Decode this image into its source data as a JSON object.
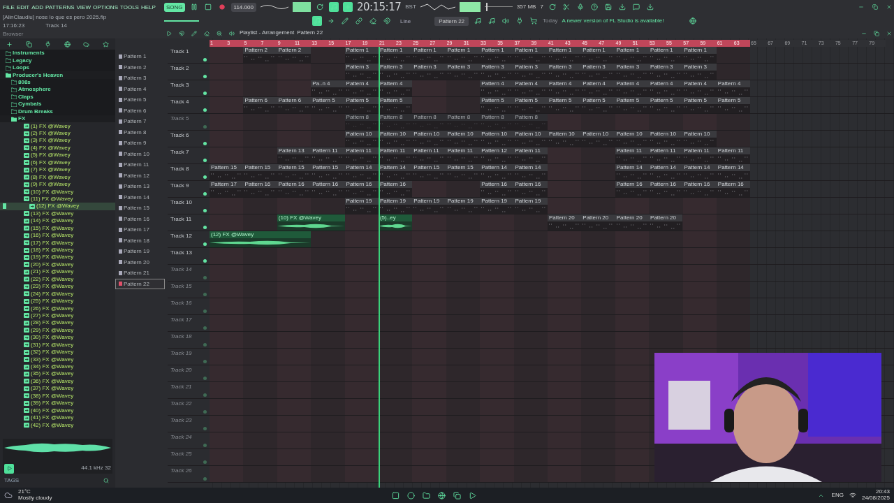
{
  "menu": [
    "FILE",
    "EDIT",
    "ADD",
    "PATTERNS",
    "VIEW",
    "OPTIONS",
    "TOOLS",
    "HELP"
  ],
  "toolbar": {
    "mode": "SONG",
    "tempo": "114.000",
    "time": "20:15:17",
    "time_unit": "BST",
    "memory": "357 MB",
    "voices": "7",
    "project": "[AlinClaudiu] nose lo que es pero 2025.flp",
    "clock": "17:16:23",
    "hint": "Track 14",
    "snap": "Line",
    "pattern": "Pattern 22",
    "news_day": "Today",
    "news": "A newer version of FL Studio is available!"
  },
  "browser": {
    "title": "Browser",
    "tree": [
      {
        "label": "Instruments",
        "expanded": false
      },
      {
        "label": "Legacy",
        "expanded": false
      },
      {
        "label": "Loops",
        "expanded": false
      },
      {
        "label": "Producer's Heaven",
        "expanded": true,
        "children": [
          {
            "label": "808s",
            "expanded": false
          },
          {
            "label": "Atmosphere",
            "expanded": false
          },
          {
            "label": "Claps",
            "expanded": false
          },
          {
            "label": "Cymbals",
            "expanded": false
          },
          {
            "label": "Drum Breaks",
            "expanded": false
          },
          {
            "label": "FX",
            "expanded": true,
            "files": [
              {
                "label": "(1) FX @Wavey",
                "selected": false
              },
              {
                "label": "(2) FX @Wavey",
                "selected": false
              },
              {
                "label": "(3) FX @Wavey",
                "selected": false
              },
              {
                "label": "(4) FX @Wavey",
                "selected": false
              },
              {
                "label": "(5) FX @Wavey",
                "selected": false
              },
              {
                "label": "(6) FX @Wavey",
                "selected": false
              },
              {
                "label": "(7) FX @Wavey",
                "selected": false
              },
              {
                "label": "(8) FX @Wavey",
                "selected": false
              },
              {
                "label": "(9) FX @Wavey",
                "selected": false
              },
              {
                "label": "(10) FX @Wavey",
                "selected": false
              },
              {
                "label": "(11) FX @Wavey",
                "selected": false
              },
              {
                "label": "(12) FX @Wavey",
                "selected": true
              },
              {
                "label": "(13) FX @Wavey",
                "selected": false
              },
              {
                "label": "(14) FX @Wavey",
                "selected": false
              },
              {
                "label": "(15) FX @Wavey",
                "selected": false
              },
              {
                "label": "(16) FX @Wavey",
                "selected": false
              },
              {
                "label": "(17) FX @Wavey",
                "selected": false
              },
              {
                "label": "(18) FX @Wavey",
                "selected": false
              },
              {
                "label": "(19) FX @Wavey",
                "selected": false
              },
              {
                "label": "(20) FX @Wavey",
                "selected": false
              },
              {
                "label": "(21) FX @Wavey",
                "selected": false
              },
              {
                "label": "(22) FX @Wavey",
                "selected": false
              },
              {
                "label": "(23) FX @Wavey",
                "selected": false
              },
              {
                "label": "(24) FX @Wavey",
                "selected": false
              },
              {
                "label": "(25) FX @Wavey",
                "selected": false
              },
              {
                "label": "(26) FX @Wavey",
                "selected": false
              },
              {
                "label": "(27) FX @Wavey",
                "selected": false
              },
              {
                "label": "(28) FX @Wavey",
                "selected": false
              },
              {
                "label": "(29) FX @Wavey",
                "selected": false
              },
              {
                "label": "(30) FX @Wavey",
                "selected": false
              },
              {
                "label": "(31) FX @Wavey",
                "selected": false
              },
              {
                "label": "(32) FX @Wavey",
                "selected": false
              },
              {
                "label": "(33) FX @Wavey",
                "selected": false
              },
              {
                "label": "(34) FX @Wavey",
                "selected": false
              },
              {
                "label": "(35) FX @Wavey",
                "selected": false
              },
              {
                "label": "(36) FX @Wavey",
                "selected": false
              },
              {
                "label": "(37) FX @Wavey",
                "selected": false
              },
              {
                "label": "(38) FX @Wavey",
                "selected": false
              },
              {
                "label": "(39) FX @Wavey",
                "selected": false
              },
              {
                "label": "(40) FX @Wavey",
                "selected": false
              },
              {
                "label": "(41) FX @Wavey",
                "selected": false
              },
              {
                "label": "(42) FX @Wavey",
                "selected": false
              }
            ]
          }
        ]
      }
    ],
    "sample_info": "44.1 kHz 32",
    "tags": "TAGS"
  },
  "playlist": {
    "title": "Playlist - Arrangement",
    "pattern": "Pattern 22",
    "patterns": [
      {
        "label": "Pattern 1",
        "selected": false
      },
      {
        "label": "Pattern 2",
        "selected": false
      },
      {
        "label": "Pattern 3",
        "selected": false
      },
      {
        "label": "Pattern 4",
        "selected": false
      },
      {
        "label": "Pattern 5",
        "selected": false
      },
      {
        "label": "Pattern 6",
        "selected": false
      },
      {
        "label": "Pattern 7",
        "selected": false
      },
      {
        "label": "Pattern 8",
        "selected": false
      },
      {
        "label": "Pattern 9",
        "selected": false
      },
      {
        "label": "Pattern 10",
        "selected": false
      },
      {
        "label": "Pattern 11",
        "selected": false
      },
      {
        "label": "Pattern 12",
        "selected": false
      },
      {
        "label": "Pattern 13",
        "selected": false
      },
      {
        "label": "Pattern 14",
        "selected": false
      },
      {
        "label": "Pattern 15",
        "selected": false
      },
      {
        "label": "Pattern 16",
        "selected": false
      },
      {
        "label": "Pattern 17",
        "selected": false
      },
      {
        "label": "Pattern 18",
        "selected": false
      },
      {
        "label": "Pattern 19",
        "selected": false
      },
      {
        "label": "Pattern 20",
        "selected": false
      },
      {
        "label": "Pattern 21",
        "selected": false
      },
      {
        "label": "Pattern 22",
        "selected": true
      }
    ],
    "ruler": [
      {
        "label": "1",
        "in_range": true
      },
      {
        "label": "3",
        "in_range": true
      },
      {
        "label": "5",
        "in_range": true
      },
      {
        "label": "7",
        "in_range": true
      },
      {
        "label": "9",
        "in_range": true
      },
      {
        "label": "11",
        "in_range": true
      },
      {
        "label": "13",
        "in_range": true
      },
      {
        "label": "15",
        "in_range": true
      },
      {
        "label": "17",
        "in_range": true
      },
      {
        "label": "19",
        "in_range": true
      },
      {
        "label": "21",
        "in_range": true
      },
      {
        "label": "23",
        "in_range": true
      },
      {
        "label": "25",
        "in_range": true
      },
      {
        "label": "27",
        "in_range": true
      },
      {
        "label": "29",
        "in_range": true
      },
      {
        "label": "31",
        "in_range": true
      },
      {
        "label": "33",
        "in_range": true
      },
      {
        "label": "35",
        "in_range": true
      },
      {
        "label": "37",
        "in_range": true
      },
      {
        "label": "39",
        "in_range": true
      },
      {
        "label": "41",
        "in_range": true
      },
      {
        "label": "43",
        "in_range": true
      },
      {
        "label": "45",
        "in_range": true
      },
      {
        "label": "47",
        "in_range": true
      },
      {
        "label": "49",
        "in_range": true
      },
      {
        "label": "51",
        "in_range": true
      },
      {
        "label": "53",
        "in_range": true
      },
      {
        "label": "55",
        "in_range": true
      },
      {
        "label": "57",
        "in_range": true
      },
      {
        "label": "59",
        "in_range": true
      },
      {
        "label": "61",
        "in_range": true
      },
      {
        "label": "63",
        "in_range": true
      },
      {
        "label": "65",
        "in_range": false
      },
      {
        "label": "67",
        "in_range": false
      },
      {
        "label": "69",
        "in_range": false
      },
      {
        "label": "71",
        "in_range": false
      },
      {
        "label": "73",
        "in_range": false
      },
      {
        "label": "75",
        "in_range": false
      },
      {
        "label": "77",
        "in_range": false
      },
      {
        "label": "79",
        "in_range": false
      }
    ],
    "tracks": [
      {
        "name": "Track 1",
        "muted": false,
        "clips": [
          {
            "kind": "gap"
          },
          {
            "kind": "pattern",
            "label": "Pattern 2"
          },
          {
            "kind": "pattern",
            "label": "Pattern 2"
          },
          {
            "kind": "gap"
          },
          {
            "kind": "pattern",
            "label": "Pattern 1"
          },
          {
            "kind": "pattern",
            "label": "Pattern 1"
          },
          {
            "kind": "pattern",
            "label": "Pattern 1"
          },
          {
            "kind": "pattern",
            "label": "Pattern 1"
          },
          {
            "kind": "pattern",
            "label": "Pattern 1"
          },
          {
            "kind": "pattern",
            "label": "Pattern 1"
          },
          {
            "kind": "pattern",
            "label": "Pattern 1"
          },
          {
            "kind": "pattern",
            "label": "Pattern 1"
          },
          {
            "kind": "pattern",
            "label": "Pattern 1"
          },
          {
            "kind": "pattern",
            "label": "Pattern 1"
          },
          {
            "kind": "pattern",
            "label": "Pattern 1"
          }
        ]
      },
      {
        "name": "Track 2",
        "muted": false,
        "clips": [
          {
            "kind": "gap"
          },
          {
            "kind": "gap"
          },
          {
            "kind": "gap"
          },
          {
            "kind": "gap"
          },
          {
            "kind": "pattern",
            "label": "Pattern 3"
          },
          {
            "kind": "pattern",
            "label": "Pattern 3"
          },
          {
            "kind": "pattern",
            "label": "Pattern 3"
          },
          {
            "kind": "pattern",
            "label": "Pattern 3"
          },
          {
            "kind": "pattern",
            "label": "Pattern 3"
          },
          {
            "kind": "pattern",
            "label": "Pattern 3"
          },
          {
            "kind": "pattern",
            "label": "Pattern 3"
          },
          {
            "kind": "pattern",
            "label": "Pattern 3"
          },
          {
            "kind": "pattern",
            "label": "Pattern 3"
          },
          {
            "kind": "pattern",
            "label": "Pattern 3"
          },
          {
            "kind": "pattern",
            "label": "Pattern 3"
          }
        ]
      },
      {
        "name": "Track 3",
        "muted": false,
        "clips": [
          {
            "kind": "gap"
          },
          {
            "kind": "gap"
          },
          {
            "kind": "gap"
          },
          {
            "kind": "pattern",
            "label": "Pa..n 4"
          },
          {
            "kind": "pattern",
            "label": "Pattern 4"
          },
          {
            "kind": "pattern",
            "label": "Pattern 4"
          },
          {
            "kind": "gap"
          },
          {
            "kind": "gap"
          },
          {
            "kind": "pattern",
            "label": "Pattern 4"
          },
          {
            "kind": "pattern",
            "label": "Pattern 4"
          },
          {
            "kind": "pattern",
            "label": "Pattern 4"
          },
          {
            "kind": "pattern",
            "label": "Pattern 4"
          },
          {
            "kind": "pattern",
            "label": "Pattern 4"
          },
          {
            "kind": "pattern",
            "label": "Pattern 4"
          },
          {
            "kind": "pattern",
            "label": "Pattern 4"
          },
          {
            "kind": "pattern",
            "label": "Pattern 4"
          }
        ]
      },
      {
        "name": "Track 4",
        "muted": false,
        "clips": [
          {
            "kind": "gap"
          },
          {
            "kind": "pattern",
            "label": "Pattern 6"
          },
          {
            "kind": "pattern",
            "label": "Pattern 6"
          },
          {
            "kind": "pattern",
            "label": "Pattern 5"
          },
          {
            "kind": "pattern",
            "label": "Pattern 5"
          },
          {
            "kind": "pattern",
            "label": "Pattern 5"
          },
          {
            "kind": "gap"
          },
          {
            "kind": "gap"
          },
          {
            "kind": "pattern",
            "label": "Pattern 5"
          },
          {
            "kind": "pattern",
            "label": "Pattern 5"
          },
          {
            "kind": "pattern",
            "label": "Pattern 5"
          },
          {
            "kind": "pattern",
            "label": "Pattern 5"
          },
          {
            "kind": "pattern",
            "label": "Pattern 5"
          },
          {
            "kind": "pattern",
            "label": "Pattern 5"
          },
          {
            "kind": "pattern",
            "label": "Pattern 5"
          },
          {
            "kind": "pattern",
            "label": "Pattern 5"
          }
        ]
      },
      {
        "name": "Track 5",
        "muted": true,
        "clips": [
          {
            "kind": "gap"
          },
          {
            "kind": "gap"
          },
          {
            "kind": "gap"
          },
          {
            "kind": "gap"
          },
          {
            "kind": "pattern",
            "label": "Pattern 8"
          },
          {
            "kind": "pattern",
            "label": "Pattern 8"
          },
          {
            "kind": "pattern",
            "label": "Pattern 8"
          },
          {
            "kind": "pattern",
            "label": "Pattern 8"
          },
          {
            "kind": "pattern",
            "label": "Pattern 8"
          },
          {
            "kind": "pattern",
            "label": "Pattern 8"
          }
        ]
      },
      {
        "name": "Track 6",
        "muted": false,
        "clips": [
          {
            "kind": "gap"
          },
          {
            "kind": "gap"
          },
          {
            "kind": "gap"
          },
          {
            "kind": "gap"
          },
          {
            "kind": "pattern",
            "label": "Pattern 10"
          },
          {
            "kind": "pattern",
            "label": "Pattern 10"
          },
          {
            "kind": "pattern",
            "label": "Pattern 10"
          },
          {
            "kind": "pattern",
            "label": "Pattern 10"
          },
          {
            "kind": "pattern",
            "label": "Pattern 10"
          },
          {
            "kind": "pattern",
            "label": "Pattern 10"
          },
          {
            "kind": "pattern",
            "label": "Pattern 10"
          },
          {
            "kind": "pattern",
            "label": "Pattern 10"
          },
          {
            "kind": "pattern",
            "label": "Pattern 10"
          },
          {
            "kind": "pattern",
            "label": "Pattern 10"
          },
          {
            "kind": "pattern",
            "label": "Pattern 10"
          }
        ]
      },
      {
        "name": "Track 7",
        "muted": false,
        "clips": [
          {
            "kind": "gap"
          },
          {
            "kind": "gap"
          },
          {
            "kind": "pattern",
            "label": "Pattern 13"
          },
          {
            "kind": "pattern",
            "label": "Pattern 11"
          },
          {
            "kind": "pattern",
            "label": "Pattern 11"
          },
          {
            "kind": "pattern",
            "label": "Pattern 11"
          },
          {
            "kind": "pattern",
            "label": "Pattern 11"
          },
          {
            "kind": "pattern",
            "label": "Pattern 11"
          },
          {
            "kind": "pattern",
            "label": "Pattern 12"
          },
          {
            "kind": "pattern",
            "label": "Pattern 11"
          },
          {
            "kind": "gap"
          },
          {
            "kind": "gap"
          },
          {
            "kind": "pattern",
            "label": "Pattern 11"
          },
          {
            "kind": "pattern",
            "label": "Pattern 11"
          },
          {
            "kind": "pattern",
            "label": "Pattern 11"
          },
          {
            "kind": "pattern",
            "label": "Pattern 11"
          }
        ]
      },
      {
        "name": "Track 8",
        "muted": false,
        "clips": [
          {
            "kind": "pattern",
            "label": "Pattern 15"
          },
          {
            "kind": "pattern",
            "label": "Pattern 15"
          },
          {
            "kind": "pattern",
            "label": "Pattern 15"
          },
          {
            "kind": "pattern",
            "label": "Pattern 15"
          },
          {
            "kind": "pattern",
            "label": "Pattern 14"
          },
          {
            "kind": "pattern",
            "label": "Pattern 14"
          },
          {
            "kind": "pattern",
            "label": "Pattern 15"
          },
          {
            "kind": "pattern",
            "label": "Pattern 15"
          },
          {
            "kind": "pattern",
            "label": "Pattern 14"
          },
          {
            "kind": "pattern",
            "label": "Pattern 14"
          },
          {
            "kind": "gap"
          },
          {
            "kind": "gap"
          },
          {
            "kind": "pattern",
            "label": "Pattern 14"
          },
          {
            "kind": "pattern",
            "label": "Pattern 14"
          },
          {
            "kind": "pattern",
            "label": "Pattern 14"
          },
          {
            "kind": "pattern",
            "label": "Pattern 14"
          }
        ]
      },
      {
        "name": "Track 9",
        "muted": false,
        "clips": [
          {
            "kind": "pattern",
            "label": "Pattern 17"
          },
          {
            "kind": "pattern",
            "label": "Pattern 16"
          },
          {
            "kind": "pattern",
            "label": "Pattern 16"
          },
          {
            "kind": "pattern",
            "label": "Pattern 16"
          },
          {
            "kind": "pattern",
            "label": "Pattern 16"
          },
          {
            "kind": "pattern",
            "label": "Pattern 16"
          },
          {
            "kind": "gap"
          },
          {
            "kind": "gap"
          },
          {
            "kind": "pattern",
            "label": "Pattern 16"
          },
          {
            "kind": "pattern",
            "label": "Pattern 16"
          },
          {
            "kind": "gap"
          },
          {
            "kind": "gap"
          },
          {
            "kind": "pattern",
            "label": "Pattern 16"
          },
          {
            "kind": "pattern",
            "label": "Pattern 16"
          },
          {
            "kind": "pattern",
            "label": "Pattern 16"
          },
          {
            "kind": "pattern",
            "label": "Pattern 16"
          }
        ]
      },
      {
        "name": "Track 10",
        "muted": false,
        "clips": [
          {
            "kind": "gap"
          },
          {
            "kind": "gap"
          },
          {
            "kind": "gap"
          },
          {
            "kind": "gap"
          },
          {
            "kind": "pattern",
            "label": "Pattern 19"
          },
          {
            "kind": "pattern",
            "label": "Pattern 19"
          },
          {
            "kind": "pattern",
            "label": "Pattern 19"
          },
          {
            "kind": "pattern",
            "label": "Pattern 19"
          },
          {
            "kind": "pattern",
            "label": "Pattern 19"
          },
          {
            "kind": "pattern",
            "label": "Pattern 19"
          }
        ]
      },
      {
        "name": "Track 11",
        "muted": false,
        "clips": [
          {
            "kind": "gap"
          },
          {
            "kind": "gap"
          },
          {
            "kind": "audio",
            "label": "(10) FX @Wavey"
          },
          {
            "kind": "gap"
          },
          {
            "kind": "gap"
          },
          {
            "kind": "audio-short",
            "label": "(5)..ey"
          },
          {
            "kind": "gap"
          },
          {
            "kind": "gap"
          },
          {
            "kind": "gap"
          },
          {
            "kind": "gap"
          },
          {
            "kind": "pattern",
            "label": "Pattern 20"
          },
          {
            "kind": "pattern",
            "label": "Pattern 20"
          },
          {
            "kind": "pattern",
            "label": "Pattern 20"
          },
          {
            "kind": "pattern",
            "label": "Pattern 20"
          }
        ]
      },
      {
        "name": "Track 12",
        "muted": false,
        "clips": [
          {
            "kind": "audio-long",
            "label": "(12) FX @Wavey"
          }
        ]
      },
      {
        "name": "Track 13",
        "muted": false
      },
      {
        "name": "Track 14",
        "muted": true
      },
      {
        "name": "Track 15",
        "muted": true
      },
      {
        "name": "Track 16",
        "muted": true
      },
      {
        "name": "Track 17",
        "muted": true
      },
      {
        "name": "Track 18",
        "muted": true
      },
      {
        "name": "Track 19",
        "muted": true
      },
      {
        "name": "Track 20",
        "muted": true
      },
      {
        "name": "Track 21",
        "muted": true
      },
      {
        "name": "Track 22",
        "muted": true
      },
      {
        "name": "Track 23",
        "muted": true
      },
      {
        "name": "Track 24",
        "muted": true
      },
      {
        "name": "Track 25",
        "muted": true
      },
      {
        "name": "Track 26",
        "muted": true
      }
    ]
  },
  "taskbar": {
    "temperature": "21°C",
    "weather": "Mostly cloudy",
    "language": "ENG",
    "time": "20:43",
    "date": "24/08/2025"
  }
}
